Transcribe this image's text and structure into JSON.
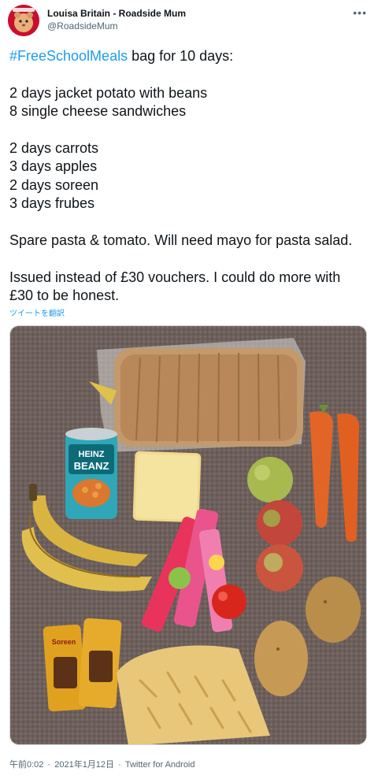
{
  "author": {
    "display_name": "Louisa Britain - Roadside Mum",
    "handle": "@RoadsideMum",
    "avatar_icon": "hamster-avatar-icon"
  },
  "more_icon": "more-horizontal-icon",
  "tweet": {
    "hashtag": "#FreeSchoolMeals",
    "first_line_rest": " bag for 10 days:",
    "lines": [
      "2 days jacket potato with beans",
      "8 single cheese sandwiches",
      "",
      "2 days carrots",
      "3 days apples",
      "2 days soreen",
      "3 days frubes",
      "",
      "Spare pasta & tomato. Will need mayo for pasta salad.",
      "",
      "Issued instead of £30 vouchers. I could do more with",
      "£30 to be honest."
    ],
    "translate_label": "ツイートを翻訳"
  },
  "photo": {
    "bean_tin_brand": "HEINZ",
    "bean_tin_label": "BEANZ",
    "soreen_label": "Soreen"
  },
  "meta": {
    "time": "午前0:02",
    "separator": "·",
    "date": "2021年1月12日",
    "source": "Twitter for Android"
  },
  "colors": {
    "link": "#1d9bf0",
    "text": "#0f1419",
    "secondary": "#536471"
  }
}
